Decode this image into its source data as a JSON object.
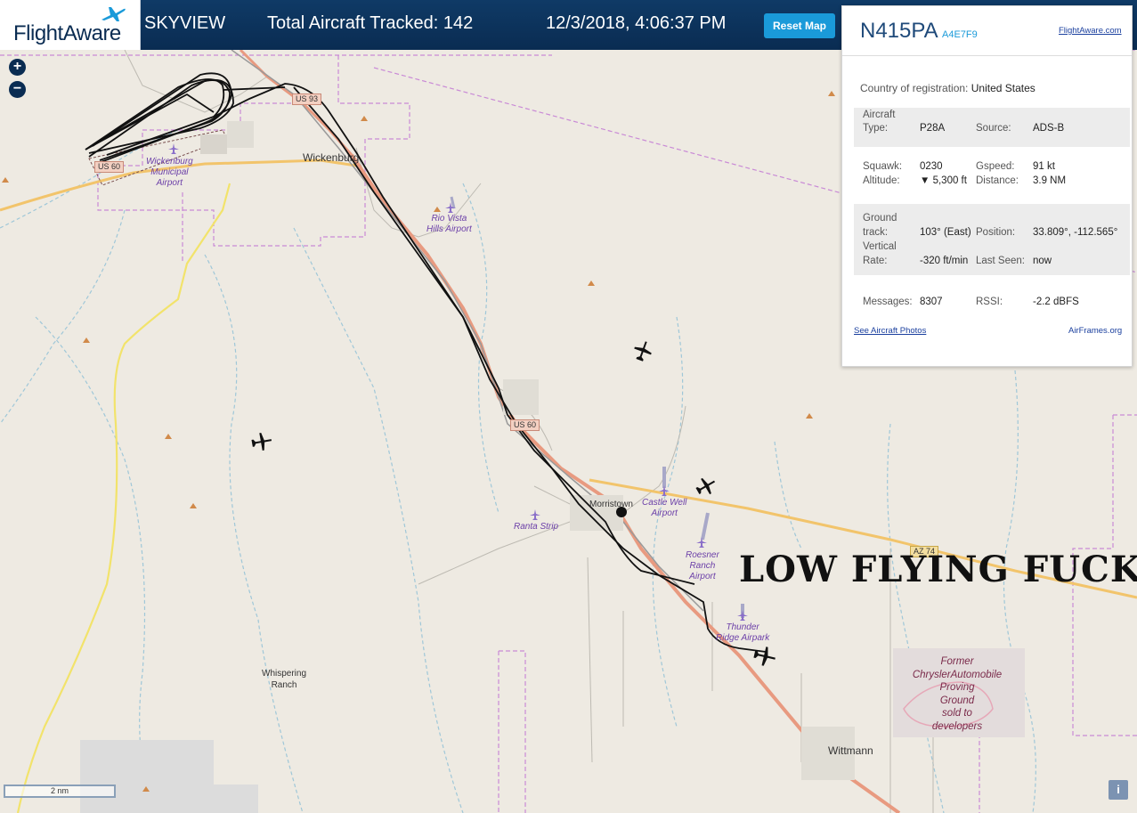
{
  "header": {
    "logo_text": "FlightAware",
    "app_name": "SKYVIEW",
    "tracked": "Total Aircraft Tracked: 142",
    "datetime": "12/3/2018, 4:06:37 PM",
    "reset_label": "Reset Map"
  },
  "map": {
    "places": [
      {
        "name": "Wickenburg"
      },
      {
        "name": "Morristown"
      },
      {
        "name": "Wittmann"
      },
      {
        "name": "Whispering\nRanch"
      }
    ],
    "airports": [
      {
        "name": "Wickenburg\nMunicipal\nAirport"
      },
      {
        "name": "Rio Vista\nHills Airport"
      },
      {
        "name": "Castle Well\nAirport"
      },
      {
        "name": "Ranta Strip"
      },
      {
        "name": "Roesner\nRanch\nAirport"
      },
      {
        "name": "Thunder\nRidge Airpark"
      }
    ],
    "highways": {
      "us60_a": "US 60",
      "us93": "US 93",
      "us60_b": "US 60",
      "az74": "AZ 74"
    },
    "proving_ground": "Former\nChryslerAutomobile\nProving\nGround\nsold to\ndevelopers",
    "caption": "LOW FLYING FUCK",
    "scale": "2 nm",
    "zoom_in": "+",
    "zoom_out": "−",
    "info": "i",
    "colors": {
      "background": "#eeeae2",
      "road_major": "#e89a80",
      "road_state": "#f2c46b",
      "track": "#111111",
      "boundary": "#c98ad6",
      "water": "#9fc7d8"
    }
  },
  "panel": {
    "ident": "N415PA",
    "hex": "A4E7F9",
    "fa_link": "FlightAware.com",
    "country_label": "Country of registration:",
    "country": "United States",
    "aircraft_type_label_1": "Aircraft",
    "aircraft_type_label_2": "Type:",
    "aircraft_type": "P28A",
    "source_label": "Source:",
    "source": "ADS-B",
    "squawk_label": "Squawk:",
    "squawk": "0230",
    "gspeed_label": "Gspeed:",
    "gspeed": "91 kt",
    "altitude_label": "Altitude:",
    "altitude": "▼ 5,300 ft",
    "distance_label": "Distance:",
    "distance": "3.9 NM",
    "ground_track_label_1": "Ground",
    "ground_track_label_2": "track:",
    "ground_track": "103° (East)",
    "position_label": "Position:",
    "position": "33.809°, -112.565°",
    "vrate_label_1": "Vertical",
    "vrate_label_2": "Rate:",
    "vrate": "-320 ft/min",
    "last_seen_label": "Last Seen:",
    "last_seen": "now",
    "messages_label": "Messages:",
    "messages": "8307",
    "rssi_label": "RSSI:",
    "rssi": "-2.2 dBFS",
    "photos_link": "See Aircraft Photos",
    "airframes_link": "AirFrames.org"
  }
}
